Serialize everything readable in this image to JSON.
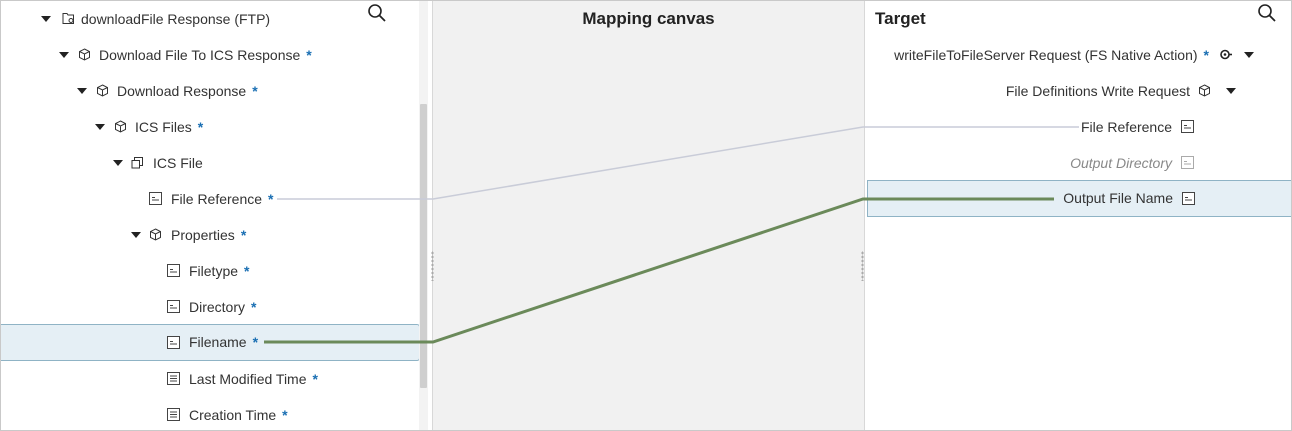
{
  "canvas": {
    "title": "Mapping canvas"
  },
  "target": {
    "title": "Target"
  },
  "source": {
    "root": {
      "label": "downloadFile Response (FTP)"
    },
    "nodes": [
      {
        "label": "Download File To ICS Response",
        "star": "*"
      },
      {
        "label": "Download Response",
        "star": "*"
      },
      {
        "label": "ICS Files",
        "star": "*"
      },
      {
        "label": "ICS File",
        "star": ""
      },
      {
        "label": "File Reference",
        "star": "*"
      },
      {
        "label": "Properties",
        "star": "*"
      },
      {
        "label": "Filetype",
        "star": "*"
      },
      {
        "label": "Directory",
        "star": "*"
      },
      {
        "label": "Filename",
        "star": "*"
      },
      {
        "label": "Last Modified Time",
        "star": "*"
      },
      {
        "label": "Creation Time",
        "star": "*"
      }
    ]
  },
  "target_tree": {
    "nodes": [
      {
        "label": "writeFileToFileServer Request (FS Native Action)",
        "star": "*"
      },
      {
        "label": "File Definitions Write Request"
      },
      {
        "label": "File Reference"
      },
      {
        "label": "Output Directory"
      },
      {
        "label": "Output File Name"
      }
    ]
  },
  "icons": {
    "search": "search-icon",
    "folder": "folder-doc-icon",
    "cube": "cube-icon",
    "collection": "collection-icon",
    "string_field": "string-field-icon",
    "date_field": "date-field-icon",
    "function": "function-icon"
  },
  "colors": {
    "mapped_line": "#6b8a5a",
    "unmapped_line": "#c9ccd8",
    "selection_bg": "#e5eff5",
    "required_star": "#1a6fb3"
  }
}
